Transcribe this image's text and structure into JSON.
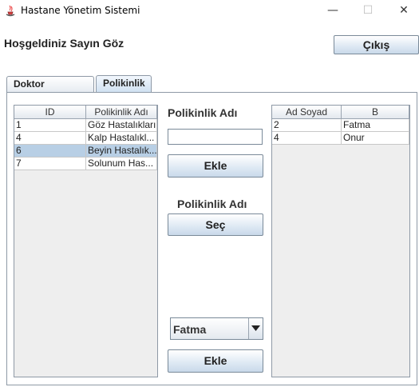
{
  "window": {
    "title": "Hastane Yönetim Sistemi",
    "minimize_glyph": "—",
    "maximize_glyph": "☐",
    "close_glyph": "✕"
  },
  "header": {
    "welcome": "Hoşgeldiniz Sayın Göz",
    "exit_label": "Çıkış"
  },
  "tabs": [
    {
      "label": "Doktor Yönetimi",
      "active": false
    },
    {
      "label": "Polikinlik",
      "active": true
    }
  ],
  "clinic_table": {
    "columns": [
      "ID",
      "Polikinlik Adı"
    ],
    "rows": [
      {
        "id": "1",
        "name": "Göz Hastalıkları",
        "selected": false
      },
      {
        "id": "4",
        "name": "Kalp Hastalıkl...",
        "selected": false
      },
      {
        "id": "6",
        "name": "Beyin Hastalık...",
        "selected": true
      },
      {
        "id": "7",
        "name": "Solunum Has...",
        "selected": false
      }
    ]
  },
  "form": {
    "clinic_name_label": "Polikinlik Adı",
    "clinic_name_value": "",
    "add_button": "Ekle",
    "select_label": "Polikinlik Adı",
    "select_button": "Seç",
    "doctor_combo_value": "Fatma",
    "add_doctor_button": "Ekle"
  },
  "doctor_table": {
    "columns": [
      "Ad Soyad",
      "B"
    ],
    "rows": [
      {
        "id": "2",
        "name": "Fatma"
      },
      {
        "id": "4",
        "name": "Onur"
      }
    ]
  },
  "colors": {
    "selection": "#b8cfe5",
    "button_gradient_end": "#c9d9ea"
  }
}
